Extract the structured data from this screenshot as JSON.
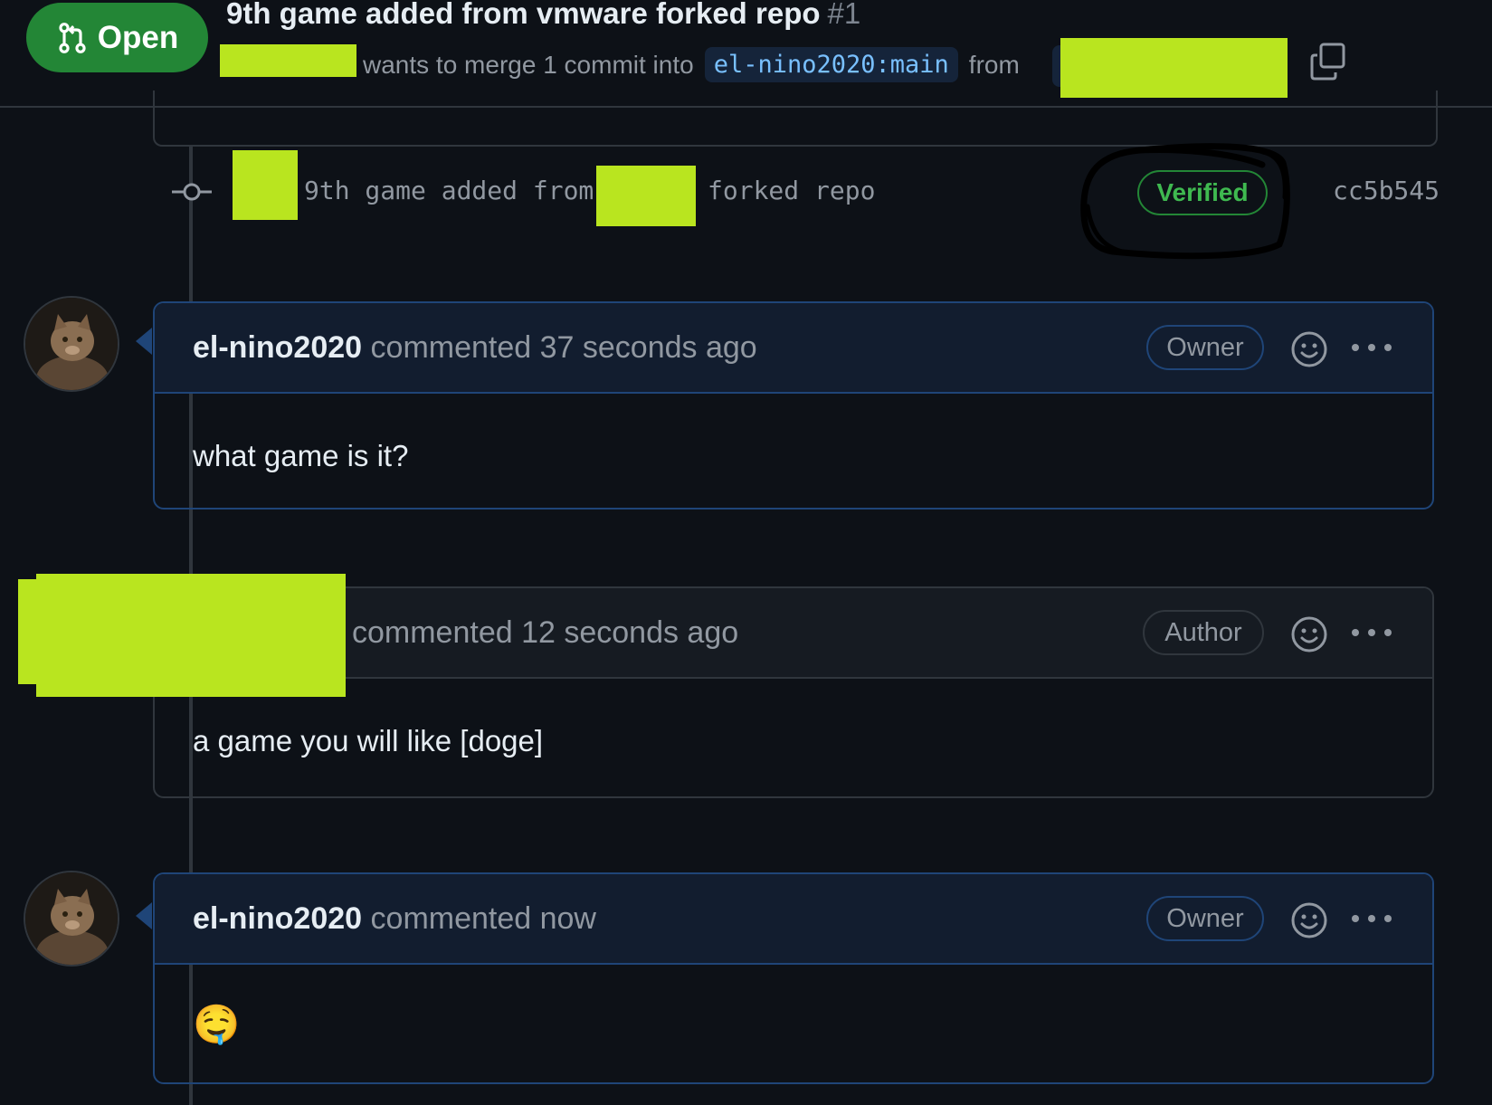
{
  "header": {
    "state_label": "Open",
    "title": "9th game added from vmware forked repo",
    "number": "#1",
    "merge_text": "wants to merge 1 commit into",
    "base_branch": "el-nino2020:main",
    "from_label": "from"
  },
  "commit": {
    "message_part1": "9th game added from",
    "message_part2": "forked repo",
    "verified_label": "Verified",
    "sha": "cc5b545"
  },
  "comments": [
    {
      "user": "el-nino2020",
      "meta": "commented 37 seconds ago",
      "role": "Owner",
      "body": "what game is it?"
    },
    {
      "user": "",
      "meta": "commented 12 seconds ago",
      "role": "Author",
      "body": "a game you will like [doge]"
    },
    {
      "user": "el-nino2020",
      "meta": "commented now",
      "role": "Owner",
      "body": "🤤"
    }
  ],
  "colors": {
    "background": "#0d1117",
    "open_badge": "#238636",
    "verified": "#3fb950",
    "branch_text": "#79c0ff",
    "redaction": "#b9e51f"
  },
  "icons": [
    "git-pull-request-icon",
    "copy-icon",
    "git-commit-icon",
    "smiley-icon",
    "kebab-menu-icon"
  ]
}
